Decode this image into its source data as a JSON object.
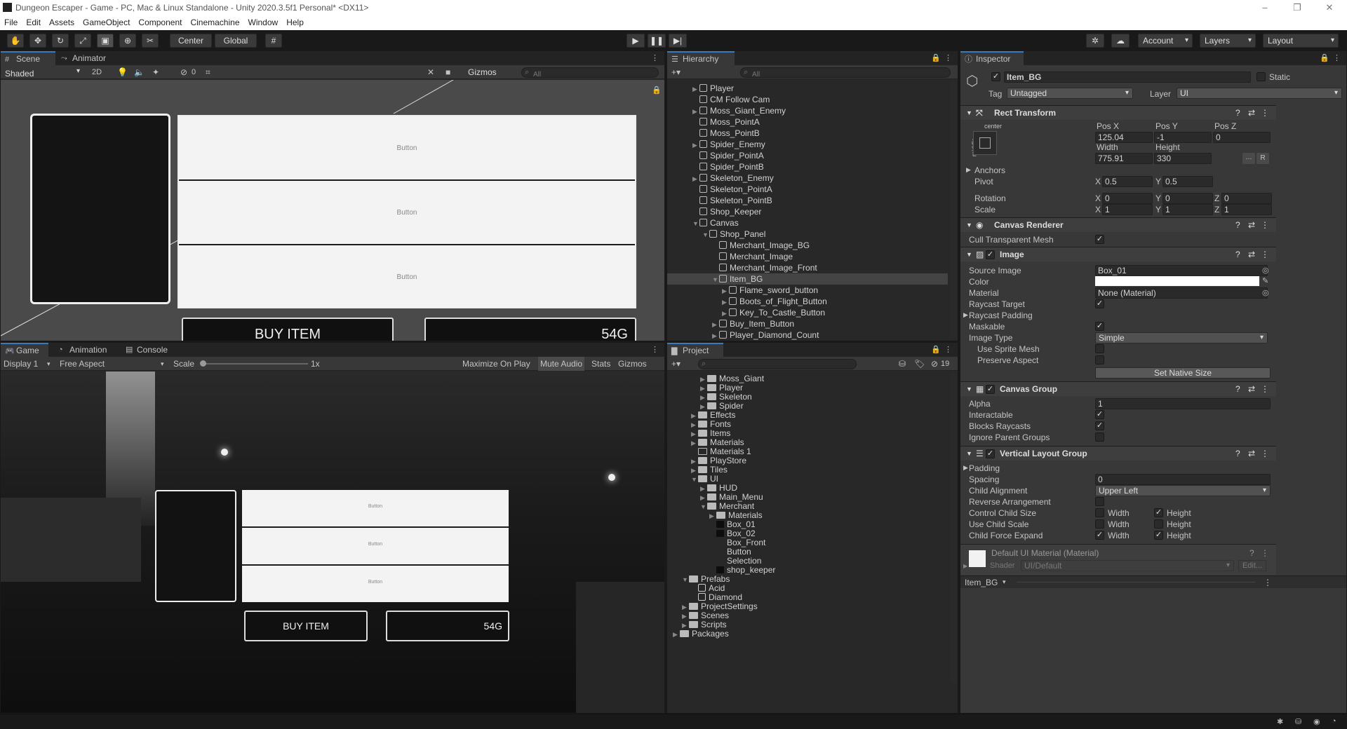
{
  "window": {
    "title": "Dungeon Escaper - Game - PC, Mac & Linux Standalone - Unity 2020.3.5f1 Personal* <DX11>"
  },
  "menu": [
    "File",
    "Edit",
    "Assets",
    "GameObject",
    "Component",
    "Cinemachine",
    "Window",
    "Help"
  ],
  "toolbar": {
    "center": "Center",
    "global": "Global",
    "account": "Account",
    "layers": "Layers",
    "layout": "Layout"
  },
  "scene": {
    "tabs": [
      "Scene",
      "Animator"
    ],
    "shading": "Shaded",
    "mode2d": "2D",
    "hidden_count": "0",
    "gizmos": "Gizmos",
    "search": "All",
    "button_labels": [
      "Button",
      "Button",
      "Button"
    ],
    "buy_partial": "BUY ITEM",
    "gold_partial": "54G"
  },
  "game": {
    "tabs": [
      "Game",
      "Animation",
      "Console"
    ],
    "display": "Display 1",
    "aspect": "Free Aspect",
    "scale_label": "Scale",
    "scale_value": "1x",
    "options": [
      "Maximize On Play",
      "Mute Audio",
      "Stats",
      "Gizmos"
    ],
    "button_labels": [
      "Button",
      "Button",
      "Button"
    ],
    "buy": "BUY ITEM",
    "gold": "54G"
  },
  "hierarchy": {
    "tab": "Hierarchy",
    "search": "All",
    "items": [
      {
        "name": "Player",
        "indent": 0,
        "arrow": true
      },
      {
        "name": "CM Follow Cam",
        "indent": 0,
        "arrow": false
      },
      {
        "name": "Moss_Giant_Enemy",
        "indent": 0,
        "arrow": true
      },
      {
        "name": "Moss_PointA",
        "indent": 0,
        "arrow": false
      },
      {
        "name": "Moss_PointB",
        "indent": 0,
        "arrow": false
      },
      {
        "name": "Spider_Enemy",
        "indent": 0,
        "arrow": true
      },
      {
        "name": "Spider_PointA",
        "indent": 0,
        "arrow": false
      },
      {
        "name": "Spider_PointB",
        "indent": 0,
        "arrow": false
      },
      {
        "name": "Skeleton_Enemy",
        "indent": 0,
        "arrow": true
      },
      {
        "name": "Skeleton_PointA",
        "indent": 0,
        "arrow": false
      },
      {
        "name": "Skeleton_PointB",
        "indent": 0,
        "arrow": false
      },
      {
        "name": "Shop_Keeper",
        "indent": 0,
        "arrow": false
      },
      {
        "name": "Canvas",
        "indent": 0,
        "arrow": true
      },
      {
        "name": "Shop_Panel",
        "indent": 1,
        "arrow": true
      },
      {
        "name": "Merchant_Image_BG",
        "indent": 2,
        "arrow": false
      },
      {
        "name": "Merchant_Image",
        "indent": 2,
        "arrow": false
      },
      {
        "name": "Merchant_Image_Front",
        "indent": 2,
        "arrow": false
      },
      {
        "name": "Item_BG",
        "indent": 2,
        "arrow": true,
        "selected": true
      },
      {
        "name": "Flame_sword_button",
        "indent": 3,
        "arrow": true
      },
      {
        "name": "Boots_of_Flight_Button",
        "indent": 3,
        "arrow": true
      },
      {
        "name": "Key_To_Castle_Button",
        "indent": 3,
        "arrow": true
      },
      {
        "name": "Buy_Item_Button",
        "indent": 2,
        "arrow": true
      },
      {
        "name": "Player_Diamond_Count",
        "indent": 2,
        "arrow": true
      }
    ]
  },
  "project": {
    "tab": "Project",
    "hidden_count": "19",
    "items": [
      {
        "name": "Moss_Giant",
        "indent": 3,
        "kind": "folder"
      },
      {
        "name": "Player",
        "indent": 3,
        "kind": "folder"
      },
      {
        "name": "Skeleton",
        "indent": 3,
        "kind": "folder"
      },
      {
        "name": "Spider",
        "indent": 3,
        "kind": "folder"
      },
      {
        "name": "Effects",
        "indent": 2,
        "kind": "folder"
      },
      {
        "name": "Fonts",
        "indent": 2,
        "kind": "folder"
      },
      {
        "name": "Items",
        "indent": 2,
        "kind": "folder"
      },
      {
        "name": "Materials",
        "indent": 2,
        "kind": "folder"
      },
      {
        "name": "Materials 1",
        "indent": 2,
        "kind": "folder-empty"
      },
      {
        "name": "PlayStore",
        "indent": 2,
        "kind": "folder"
      },
      {
        "name": "Tiles",
        "indent": 2,
        "kind": "folder"
      },
      {
        "name": "UI",
        "indent": 2,
        "kind": "folder"
      },
      {
        "name": "HUD",
        "indent": 3,
        "kind": "folder"
      },
      {
        "name": "Main_Menu",
        "indent": 3,
        "kind": "folder"
      },
      {
        "name": "Merchant",
        "indent": 3,
        "kind": "folder"
      },
      {
        "name": "Materials",
        "indent": 4,
        "kind": "folder"
      },
      {
        "name": "Box_01",
        "indent": 4,
        "kind": "sprite-dark"
      },
      {
        "name": "Box_02",
        "indent": 4,
        "kind": "sprite-dark"
      },
      {
        "name": "Box_Front",
        "indent": 4,
        "kind": "sprite"
      },
      {
        "name": "Button",
        "indent": 4,
        "kind": "sprite"
      },
      {
        "name": "Selection",
        "indent": 4,
        "kind": "sprite"
      },
      {
        "name": "shop_keeper",
        "indent": 4,
        "kind": "sprite-dark"
      },
      {
        "name": "Prefabs",
        "indent": 1,
        "kind": "folder"
      },
      {
        "name": "Acid",
        "indent": 2,
        "kind": "prefab"
      },
      {
        "name": "Diamond",
        "indent": 2,
        "kind": "prefab"
      },
      {
        "name": "ProjectSettings",
        "indent": 1,
        "kind": "folder"
      },
      {
        "name": "Scenes",
        "indent": 1,
        "kind": "folder"
      },
      {
        "name": "Scripts",
        "indent": 1,
        "kind": "folder"
      },
      {
        "name": "Packages",
        "indent": 0,
        "kind": "folder"
      }
    ]
  },
  "inspector": {
    "tab": "Inspector",
    "object_name": "Item_BG",
    "static": "Static",
    "tag_label": "Tag",
    "tag": "Untagged",
    "layer_label": "Layer",
    "layer": "UI",
    "rect": {
      "title": "Rect Transform",
      "anchor_h": "center",
      "anchor_v": "middle",
      "posx_label": "Pos X",
      "posy_label": "Pos Y",
      "posz_label": "Pos Z",
      "posx": "125.04",
      "posy": "-1",
      "posz": "0",
      "width_label": "Width",
      "height_label": "Height",
      "width": "775.91",
      "height": "330",
      "anchors": "Anchors",
      "pivot": "Pivot",
      "pivot_x": "0.5",
      "pivot_y": "0.5",
      "rotation": "Rotation",
      "rot_x": "0",
      "rot_y": "0",
      "rot_z": "0",
      "scale": "Scale",
      "scale_x": "1",
      "scale_y": "1",
      "scale_z": "1",
      "raw_btn": "R"
    },
    "canvas_renderer": {
      "title": "Canvas Renderer",
      "cull_label": "Cull Transparent Mesh"
    },
    "image": {
      "title": "Image",
      "source_label": "Source Image",
      "source": "Box_01",
      "color_label": "Color",
      "material_label": "Material",
      "material": "None (Material)",
      "raycast_label": "Raycast Target",
      "padding_label": "Raycast Padding",
      "maskable_label": "Maskable",
      "type_label": "Image Type",
      "type": "Simple",
      "sprite_mesh_label": "Use Sprite Mesh",
      "preserve_label": "Preserve Aspect",
      "native_btn": "Set Native Size"
    },
    "canvas_group": {
      "title": "Canvas Group",
      "alpha_label": "Alpha",
      "alpha": "1",
      "interactable_label": "Interactable",
      "blocks_label": "Blocks Raycasts",
      "ignore_label": "Ignore Parent Groups"
    },
    "vlg": {
      "title": "Vertical Layout Group",
      "padding_label": "Padding",
      "spacing_label": "Spacing",
      "spacing": "0",
      "align_label": "Child Alignment",
      "align": "Upper Left",
      "reverse_label": "Reverse Arrangement",
      "control_label": "Control Child Size",
      "scale_label": "Use Child Scale",
      "force_label": "Child Force Expand",
      "width": "Width",
      "height": "Height"
    },
    "material": {
      "title": "Default UI Material (Material)",
      "shader_label": "Shader",
      "shader": "UI/Default",
      "edit": "Edit..."
    },
    "footer": "Item_BG"
  }
}
